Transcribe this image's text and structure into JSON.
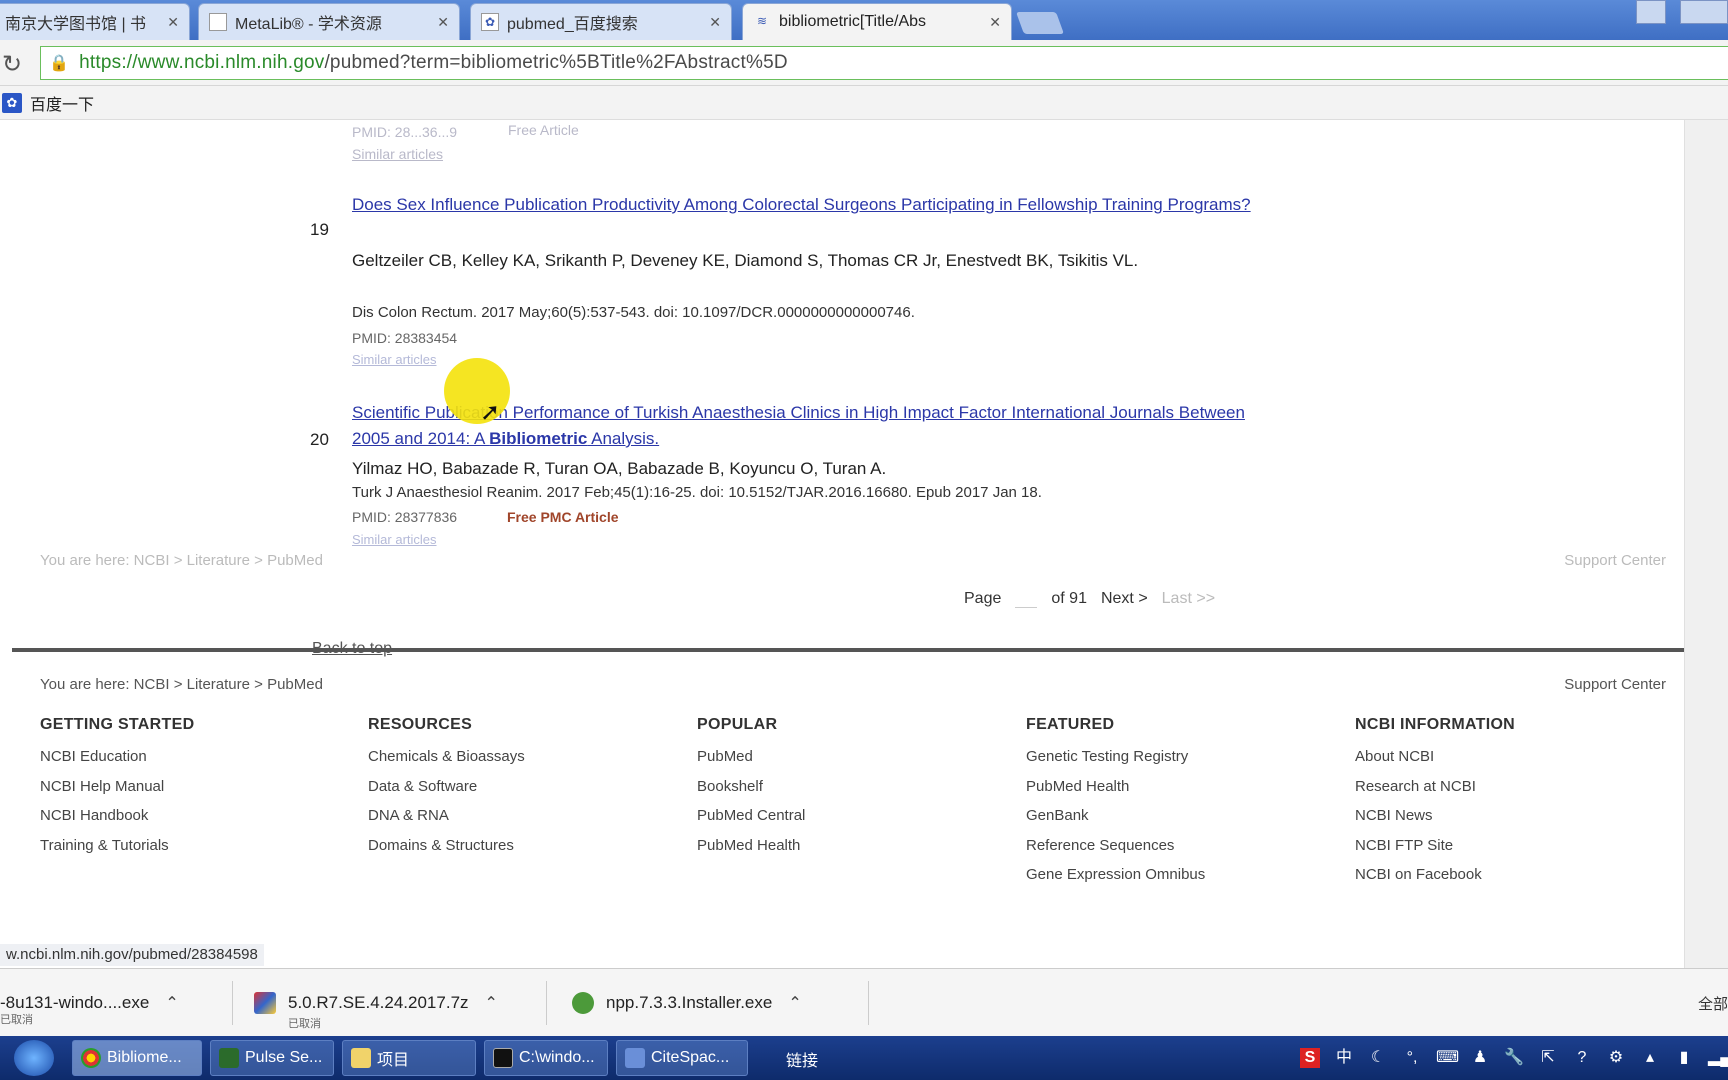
{
  "browser": {
    "tabs": [
      {
        "title": "南京大学图书馆 | 书",
        "icon": "library-icon"
      },
      {
        "title": "MetaLib® - 学术资源",
        "icon": "page-icon"
      },
      {
        "title": "pubmed_百度搜索",
        "icon": "baidu-icon"
      },
      {
        "title": "bibliometric[Title/Abs",
        "icon": "ncbi-icon"
      }
    ],
    "url_host": "https://www.ncbi.nlm.nih.gov",
    "url_path": "/pubmed?term=bibliometric%5BTitle%2FAbstract%5D",
    "bookmark": "百度一下"
  },
  "results": {
    "prev_ghost": {
      "pmid": "PMID: 28...36...9",
      "free": "Free Article",
      "similar": "Similar articles"
    },
    "items": [
      {
        "num": "19",
        "title": "Does Sex Influence Publication Productivity Among Colorectal Surgeons Participating in Fellowship Training Programs?",
        "authors": "Geltzeiler CB, Kelley KA, Srikanth P, Deveney KE, Diamond S, Thomas CR Jr, Enestvedt BK, Tsikitis VL.",
        "journal": "Dis Colon Rectum. 2017 May;60(5):537-543. doi: 10.1097/DCR.0000000000000746.",
        "pmid": "PMID: 28383454",
        "similar": "Similar articles"
      },
      {
        "num": "20",
        "title_pre": "Scientific Publication Performance of Turkish Anaesthesia Clinics in High Impact Factor International Journals Between 2005 and 2014: A ",
        "title_bold": "Bibliometric",
        "title_post": " Analysis.",
        "authors": "Yilmaz HO, Babazade R, Turan OA, Babazade B, Koyuncu O, Turan A.",
        "journal": "Turk J Anaesthesiol Reanim. 2017 Feb;45(1):16-25. doi: 10.5152/TJAR.2016.16680. Epub 2017 Jan 18.",
        "pmid": "PMID: 28377836",
        "free": "Free PMC Article",
        "similar": "Similar articles"
      }
    ]
  },
  "pager": {
    "page_label": "Page",
    "of": "of 91",
    "next": "Next >",
    "last": "Last >>"
  },
  "back_to_top": "Back to top",
  "footer": {
    "breadcrumb": "You are here: NCBI > Literature > PubMed",
    "support": "Support Center",
    "columns": [
      {
        "head": "GETTING STARTED",
        "links": [
          "NCBI Education",
          "NCBI Help Manual",
          "NCBI Handbook",
          "Training & Tutorials"
        ]
      },
      {
        "head": "RESOURCES",
        "links": [
          "Chemicals & Bioassays",
          "Data & Software",
          "DNA & RNA",
          "Domains & Structures"
        ]
      },
      {
        "head": "POPULAR",
        "links": [
          "PubMed",
          "Bookshelf",
          "PubMed Central",
          "PubMed Health"
        ]
      },
      {
        "head": "FEATURED",
        "links": [
          "Genetic Testing Registry",
          "PubMed Health",
          "GenBank",
          "Reference Sequences",
          "Gene Expression Omnibus"
        ]
      },
      {
        "head": "NCBI INFORMATION",
        "links": [
          "About NCBI",
          "Research at NCBI",
          "NCBI News",
          "NCBI FTP Site",
          "NCBI on Facebook"
        ]
      }
    ]
  },
  "status_url": "w.ncbi.nlm.nih.gov/pubmed/28384598",
  "downloads": {
    "items": [
      {
        "name": "-8u131-windo....exe",
        "sub": "已取消"
      },
      {
        "name": "5.0.R7.SE.4.24.2017.7z",
        "sub": "已取消"
      },
      {
        "name": "npp.7.3.3.Installer.exe",
        "sub": ""
      }
    ],
    "show_all": "全部"
  },
  "taskbar": {
    "tasks": [
      {
        "label": "Bibliome..."
      },
      {
        "label": "Pulse Se..."
      },
      {
        "label": "项目"
      },
      {
        "label": "C:\\windo..."
      },
      {
        "label": "CiteSpac..."
      }
    ],
    "links_label": "链接",
    "ime": "中"
  }
}
